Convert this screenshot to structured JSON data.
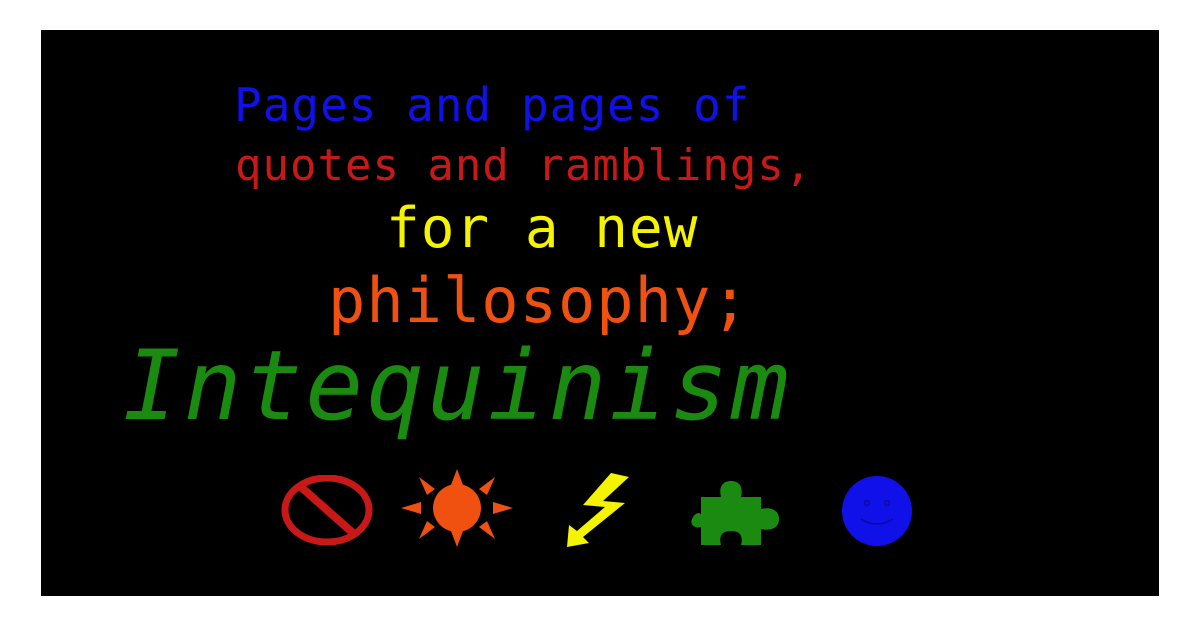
{
  "banner": {
    "lines": [
      {
        "text": "Pages and pages of",
        "color": "#1010e8"
      },
      {
        "text": "quotes and ramblings,",
        "color": "#c81818"
      },
      {
        "text": "for a new",
        "color": "#f4f400"
      },
      {
        "text": "philosophy;",
        "color": "#f05010"
      },
      {
        "text": "Intequinism",
        "color": "#1a8a10"
      }
    ]
  },
  "icons": [
    {
      "name": "no-symbol-icon",
      "color": "#c81818"
    },
    {
      "name": "sun-icon",
      "color": "#f05010"
    },
    {
      "name": "lightning-arrow-icon",
      "color": "#f4f400"
    },
    {
      "name": "puzzle-piece-icon",
      "color": "#1a8a10"
    },
    {
      "name": "smiley-face-icon",
      "color": "#1010e8"
    }
  ]
}
